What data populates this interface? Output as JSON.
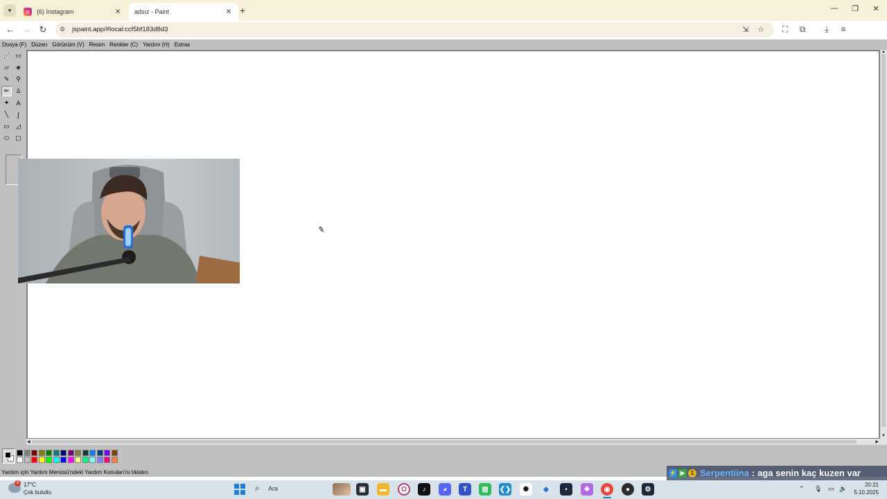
{
  "browser": {
    "tabs": [
      {
        "title": "(6) Instagram",
        "icon": "instagram-icon"
      },
      {
        "title": "adsız - Paint",
        "icon": "paint-icon"
      }
    ],
    "new_tab_glyph": "+",
    "url": "jspaint.app/#local:ccf5bf183d8d3"
  },
  "paint": {
    "menu": [
      "Dosya (F)",
      "Düzen",
      "Görünüm (V)",
      "Resim",
      "Renkler (C)",
      "Yardım (H)",
      "Extras"
    ],
    "tools": [
      {
        "name": "free-form-select",
        "glyph": "⋰"
      },
      {
        "name": "select",
        "glyph": "▭"
      },
      {
        "name": "eraser",
        "glyph": "▱"
      },
      {
        "name": "fill",
        "glyph": "◈"
      },
      {
        "name": "pick-color",
        "glyph": "✎"
      },
      {
        "name": "magnifier",
        "glyph": "⚲"
      },
      {
        "name": "pencil",
        "glyph": "✏",
        "selected": true
      },
      {
        "name": "brush",
        "glyph": "♙"
      },
      {
        "name": "airbrush",
        "glyph": "✦"
      },
      {
        "name": "text",
        "glyph": "A"
      },
      {
        "name": "line",
        "glyph": "╲"
      },
      {
        "name": "curve",
        "glyph": "∫"
      },
      {
        "name": "rectangle",
        "glyph": "▭"
      },
      {
        "name": "polygon",
        "glyph": "◿"
      },
      {
        "name": "ellipse",
        "glyph": "⬭"
      },
      {
        "name": "rounded-rectangle",
        "glyph": "▢"
      }
    ],
    "palette_top": [
      "#000000",
      "#808080",
      "#800000",
      "#808000",
      "#008000",
      "#008080",
      "#000080",
      "#800080",
      "#808040",
      "#004040",
      "#0080ff",
      "#004080",
      "#8000ff",
      "#804000"
    ],
    "palette_bottom": [
      "#ffffff",
      "#c0c0c0",
      "#ff0000",
      "#ffff00",
      "#00ff00",
      "#00ffff",
      "#0000ff",
      "#ff00ff",
      "#ffff80",
      "#00ff80",
      "#80ffff",
      "#8080ff",
      "#ff0080",
      "#ff8040"
    ],
    "foreground_color": "#000000",
    "background_color": "#ffffff",
    "status": "Yardım için Yardım Menüsü'ndeki Yardım Konuları'nı tıklatın."
  },
  "chat": {
    "username": "Serpentiina",
    "separator": ":",
    "message": "aga senin kaç kuzen var",
    "badge_number": "1"
  },
  "taskbar": {
    "weather": {
      "badge": "8",
      "temp": "17°C",
      "desc": "Çok bulutlu"
    },
    "search_placeholder": "Ara",
    "time": "20:21",
    "date": "5.10.2025"
  }
}
